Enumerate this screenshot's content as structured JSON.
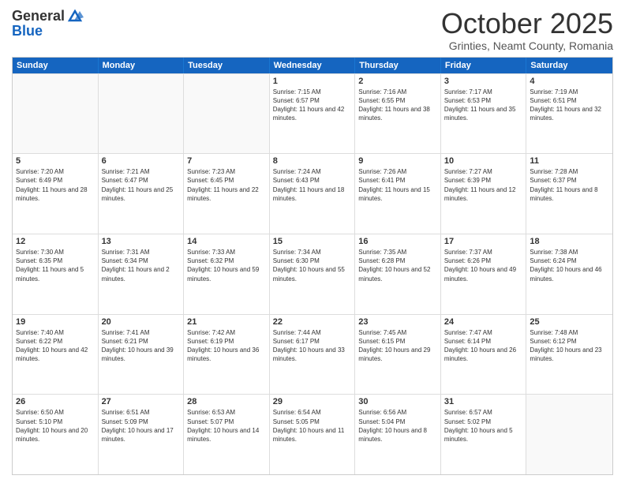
{
  "header": {
    "logo_general": "General",
    "logo_blue": "Blue",
    "month_title": "October 2025",
    "subtitle": "Grinties, Neamt County, Romania"
  },
  "weekdays": [
    "Sunday",
    "Monday",
    "Tuesday",
    "Wednesday",
    "Thursday",
    "Friday",
    "Saturday"
  ],
  "rows": [
    [
      {
        "day": "",
        "info": ""
      },
      {
        "day": "",
        "info": ""
      },
      {
        "day": "",
        "info": ""
      },
      {
        "day": "1",
        "info": "Sunrise: 7:15 AM\nSunset: 6:57 PM\nDaylight: 11 hours and 42 minutes."
      },
      {
        "day": "2",
        "info": "Sunrise: 7:16 AM\nSunset: 6:55 PM\nDaylight: 11 hours and 38 minutes."
      },
      {
        "day": "3",
        "info": "Sunrise: 7:17 AM\nSunset: 6:53 PM\nDaylight: 11 hours and 35 minutes."
      },
      {
        "day": "4",
        "info": "Sunrise: 7:19 AM\nSunset: 6:51 PM\nDaylight: 11 hours and 32 minutes."
      }
    ],
    [
      {
        "day": "5",
        "info": "Sunrise: 7:20 AM\nSunset: 6:49 PM\nDaylight: 11 hours and 28 minutes."
      },
      {
        "day": "6",
        "info": "Sunrise: 7:21 AM\nSunset: 6:47 PM\nDaylight: 11 hours and 25 minutes."
      },
      {
        "day": "7",
        "info": "Sunrise: 7:23 AM\nSunset: 6:45 PM\nDaylight: 11 hours and 22 minutes."
      },
      {
        "day": "8",
        "info": "Sunrise: 7:24 AM\nSunset: 6:43 PM\nDaylight: 11 hours and 18 minutes."
      },
      {
        "day": "9",
        "info": "Sunrise: 7:26 AM\nSunset: 6:41 PM\nDaylight: 11 hours and 15 minutes."
      },
      {
        "day": "10",
        "info": "Sunrise: 7:27 AM\nSunset: 6:39 PM\nDaylight: 11 hours and 12 minutes."
      },
      {
        "day": "11",
        "info": "Sunrise: 7:28 AM\nSunset: 6:37 PM\nDaylight: 11 hours and 8 minutes."
      }
    ],
    [
      {
        "day": "12",
        "info": "Sunrise: 7:30 AM\nSunset: 6:35 PM\nDaylight: 11 hours and 5 minutes."
      },
      {
        "day": "13",
        "info": "Sunrise: 7:31 AM\nSunset: 6:34 PM\nDaylight: 11 hours and 2 minutes."
      },
      {
        "day": "14",
        "info": "Sunrise: 7:33 AM\nSunset: 6:32 PM\nDaylight: 10 hours and 59 minutes."
      },
      {
        "day": "15",
        "info": "Sunrise: 7:34 AM\nSunset: 6:30 PM\nDaylight: 10 hours and 55 minutes."
      },
      {
        "day": "16",
        "info": "Sunrise: 7:35 AM\nSunset: 6:28 PM\nDaylight: 10 hours and 52 minutes."
      },
      {
        "day": "17",
        "info": "Sunrise: 7:37 AM\nSunset: 6:26 PM\nDaylight: 10 hours and 49 minutes."
      },
      {
        "day": "18",
        "info": "Sunrise: 7:38 AM\nSunset: 6:24 PM\nDaylight: 10 hours and 46 minutes."
      }
    ],
    [
      {
        "day": "19",
        "info": "Sunrise: 7:40 AM\nSunset: 6:22 PM\nDaylight: 10 hours and 42 minutes."
      },
      {
        "day": "20",
        "info": "Sunrise: 7:41 AM\nSunset: 6:21 PM\nDaylight: 10 hours and 39 minutes."
      },
      {
        "day": "21",
        "info": "Sunrise: 7:42 AM\nSunset: 6:19 PM\nDaylight: 10 hours and 36 minutes."
      },
      {
        "day": "22",
        "info": "Sunrise: 7:44 AM\nSunset: 6:17 PM\nDaylight: 10 hours and 33 minutes."
      },
      {
        "day": "23",
        "info": "Sunrise: 7:45 AM\nSunset: 6:15 PM\nDaylight: 10 hours and 29 minutes."
      },
      {
        "day": "24",
        "info": "Sunrise: 7:47 AM\nSunset: 6:14 PM\nDaylight: 10 hours and 26 minutes."
      },
      {
        "day": "25",
        "info": "Sunrise: 7:48 AM\nSunset: 6:12 PM\nDaylight: 10 hours and 23 minutes."
      }
    ],
    [
      {
        "day": "26",
        "info": "Sunrise: 6:50 AM\nSunset: 5:10 PM\nDaylight: 10 hours and 20 minutes."
      },
      {
        "day": "27",
        "info": "Sunrise: 6:51 AM\nSunset: 5:09 PM\nDaylight: 10 hours and 17 minutes."
      },
      {
        "day": "28",
        "info": "Sunrise: 6:53 AM\nSunset: 5:07 PM\nDaylight: 10 hours and 14 minutes."
      },
      {
        "day": "29",
        "info": "Sunrise: 6:54 AM\nSunset: 5:05 PM\nDaylight: 10 hours and 11 minutes."
      },
      {
        "day": "30",
        "info": "Sunrise: 6:56 AM\nSunset: 5:04 PM\nDaylight: 10 hours and 8 minutes."
      },
      {
        "day": "31",
        "info": "Sunrise: 6:57 AM\nSunset: 5:02 PM\nDaylight: 10 hours and 5 minutes."
      },
      {
        "day": "",
        "info": ""
      }
    ]
  ]
}
